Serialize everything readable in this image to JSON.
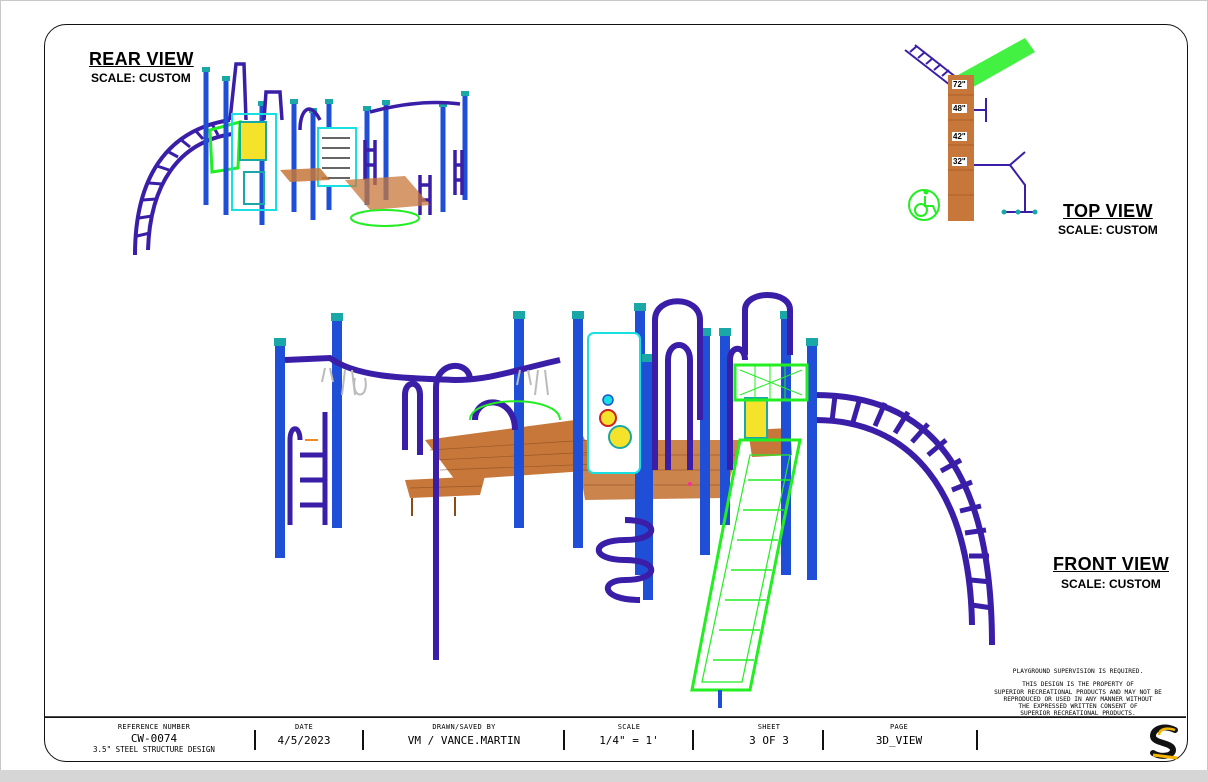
{
  "rear_view": {
    "title": "REAR VIEW",
    "scale": "SCALE: CUSTOM"
  },
  "top_view": {
    "title": "TOP VIEW",
    "scale": "SCALE: CUSTOM",
    "deck_heights": [
      "72\"",
      "48\"",
      "42\"",
      "32\""
    ]
  },
  "front_view": {
    "title": "FRONT VIEW",
    "scale": "SCALE: CUSTOM"
  },
  "notes": {
    "supervision": "PLAYGROUND SUPERVISION IS REQUIRED.",
    "property_lines": [
      "THIS DESIGN IS THE PROPERTY OF",
      "SUPERIOR RECREATIONAL PRODUCTS AND MAY NOT BE",
      "REPRODUCED OR USED IN ANY MANNER WITHOUT",
      "THE EXPRESSED WRITTEN CONSENT OF",
      "SUPERIOR RECREATIONAL PRODUCTS."
    ]
  },
  "title_block": {
    "reference_number": {
      "label": "REFERENCE NUMBER",
      "value": "CW-0074",
      "sub": "3.5\" STEEL STRUCTURE DESIGN"
    },
    "date": {
      "label": "DATE",
      "value": "4/5/2023"
    },
    "drawn_by": {
      "label": "DRAWN/SAVED BY",
      "value": "VM / VANCE.MARTIN"
    },
    "scale": {
      "label": "SCALE",
      "value": "1/4\" = 1'"
    },
    "sheet": {
      "label": "SHEET",
      "value": "3 OF 3"
    },
    "page": {
      "label": "PAGE",
      "value": "3D_VIEW"
    }
  },
  "colors": {
    "post_blue": "#1f4fd6",
    "rail_purple": "#3a1ea8",
    "slide_green": "#22ee22",
    "deck_brown": "#c7773a",
    "cap_teal": "#1aa7a7",
    "panel_cyan": "#19e0e0"
  },
  "icons": {
    "logo": "superior-s-logo",
    "accessibility": "wheelchair-icon"
  }
}
